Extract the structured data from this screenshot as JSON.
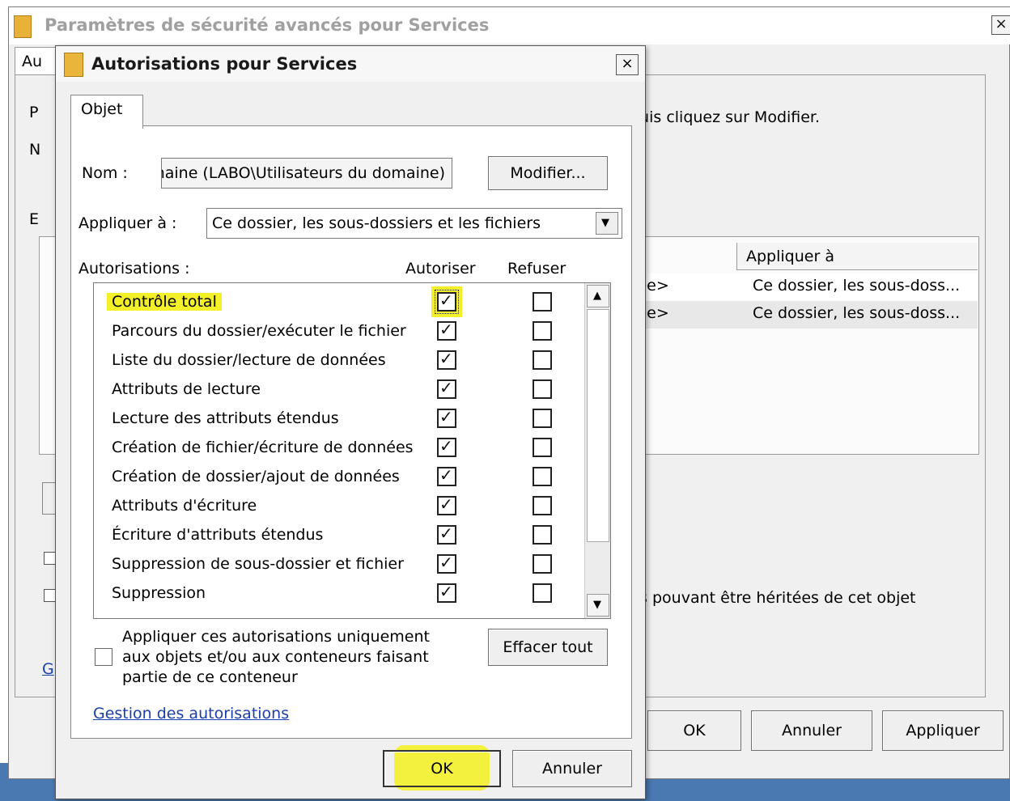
{
  "back_window": {
    "title": "Paramètres de sécurité avancés pour Services",
    "close": "×",
    "tab_fragment": "Au",
    "letters": {
      "p": "P",
      "n": "N",
      "e": "E",
      "g": "G"
    },
    "instruction_fragment": "puis cliquez sur Modifier.",
    "column_header": "Appliquer à",
    "rows": [
      {
        "fragment": "tée>",
        "apply": "Ce dossier, les sous-doss..."
      },
      {
        "fragment": "tée>",
        "apply": "Ce dossier, les sous-doss..."
      }
    ],
    "inherit_fragment": "ns pouvant être héritées de cet objet",
    "buttons": {
      "ok": "OK",
      "cancel": "Annuler",
      "apply": "Appliquer"
    }
  },
  "dialog": {
    "title": "Autorisations pour Services",
    "close": "×",
    "tab": "Objet",
    "name_label": "Nom :",
    "name_value": "omaine (LABO\\Utilisateurs du domaine)",
    "modify_button": "Modifier...",
    "apply_label": "Appliquer à :",
    "apply_value": "Ce dossier, les sous-dossiers et les fichiers",
    "permissions_label": "Autorisations :",
    "col_allow": "Autoriser",
    "col_deny": "Refuser",
    "check_glyph": "✓",
    "permissions": [
      {
        "label": "Contrôle total",
        "allow": true,
        "deny": false
      },
      {
        "label": "Parcours du dossier/exécuter le fichier",
        "allow": true,
        "deny": false
      },
      {
        "label": "Liste du dossier/lecture de données",
        "allow": true,
        "deny": false
      },
      {
        "label": "Attributs de lecture",
        "allow": true,
        "deny": false
      },
      {
        "label": "Lecture des attributs étendus",
        "allow": true,
        "deny": false
      },
      {
        "label": "Création de fichier/écriture de données",
        "allow": true,
        "deny": false
      },
      {
        "label": "Création de dossier/ajout de données",
        "allow": true,
        "deny": false
      },
      {
        "label": "Attributs d'écriture",
        "allow": true,
        "deny": false
      },
      {
        "label": "Écriture d'attributs étendus",
        "allow": true,
        "deny": false
      },
      {
        "label": "Suppression de sous-dossier et fichier",
        "allow": true,
        "deny": false
      },
      {
        "label": "Suppression",
        "allow": true,
        "deny": false
      }
    ],
    "only_apply_text": "Appliquer ces autorisations uniquement aux objets et/ou aux conteneurs faisant partie de ce conteneur",
    "clear_all_button": "Effacer tout",
    "manage_link": "Gestion des autorisations",
    "ok_button": "OK",
    "cancel_button": "Annuler"
  },
  "colors": {
    "highlight": "#f3f02a",
    "link": "#1a3fa8",
    "taskbar": "#4a78b0"
  },
  "icons": {
    "scroll_up": "▲",
    "scroll_down": "▼",
    "dropdown": "▼"
  }
}
